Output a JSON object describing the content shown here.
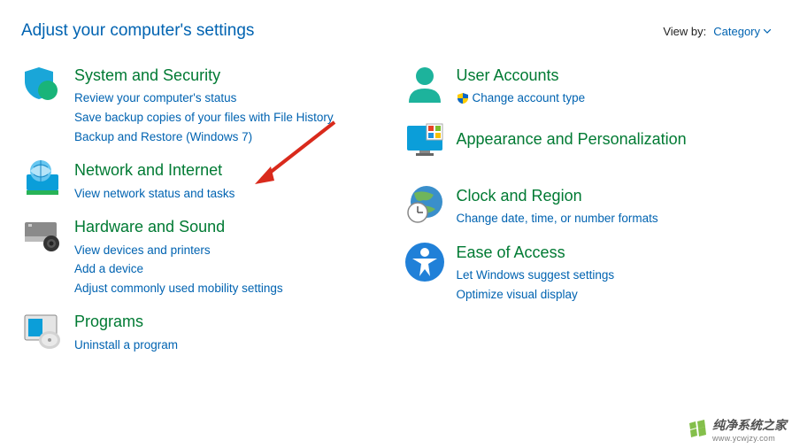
{
  "header": {
    "title": "Adjust your computer's settings",
    "view_by_label": "View by:",
    "view_by_value": "Category"
  },
  "left": {
    "system": {
      "title": "System and Security",
      "links": [
        "Review your computer's status",
        "Save backup copies of your files with File History",
        "Backup and Restore (Windows 7)"
      ]
    },
    "network": {
      "title": "Network and Internet",
      "links": [
        "View network status and tasks"
      ]
    },
    "hardware": {
      "title": "Hardware and Sound",
      "links": [
        "View devices and printers",
        "Add a device",
        "Adjust commonly used mobility settings"
      ]
    },
    "programs": {
      "title": "Programs",
      "links": [
        "Uninstall a program"
      ]
    }
  },
  "right": {
    "user": {
      "title": "User Accounts",
      "links": [
        "Change account type"
      ]
    },
    "appearance": {
      "title": "Appearance and Personalization"
    },
    "clock": {
      "title": "Clock and Region",
      "links": [
        "Change date, time, or number formats"
      ]
    },
    "ease": {
      "title": "Ease of Access",
      "links": [
        "Let Windows suggest settings",
        "Optimize visual display"
      ]
    }
  },
  "watermark": {
    "main": "纯净系统之家",
    "sub": "www.ycwjzy.com"
  }
}
